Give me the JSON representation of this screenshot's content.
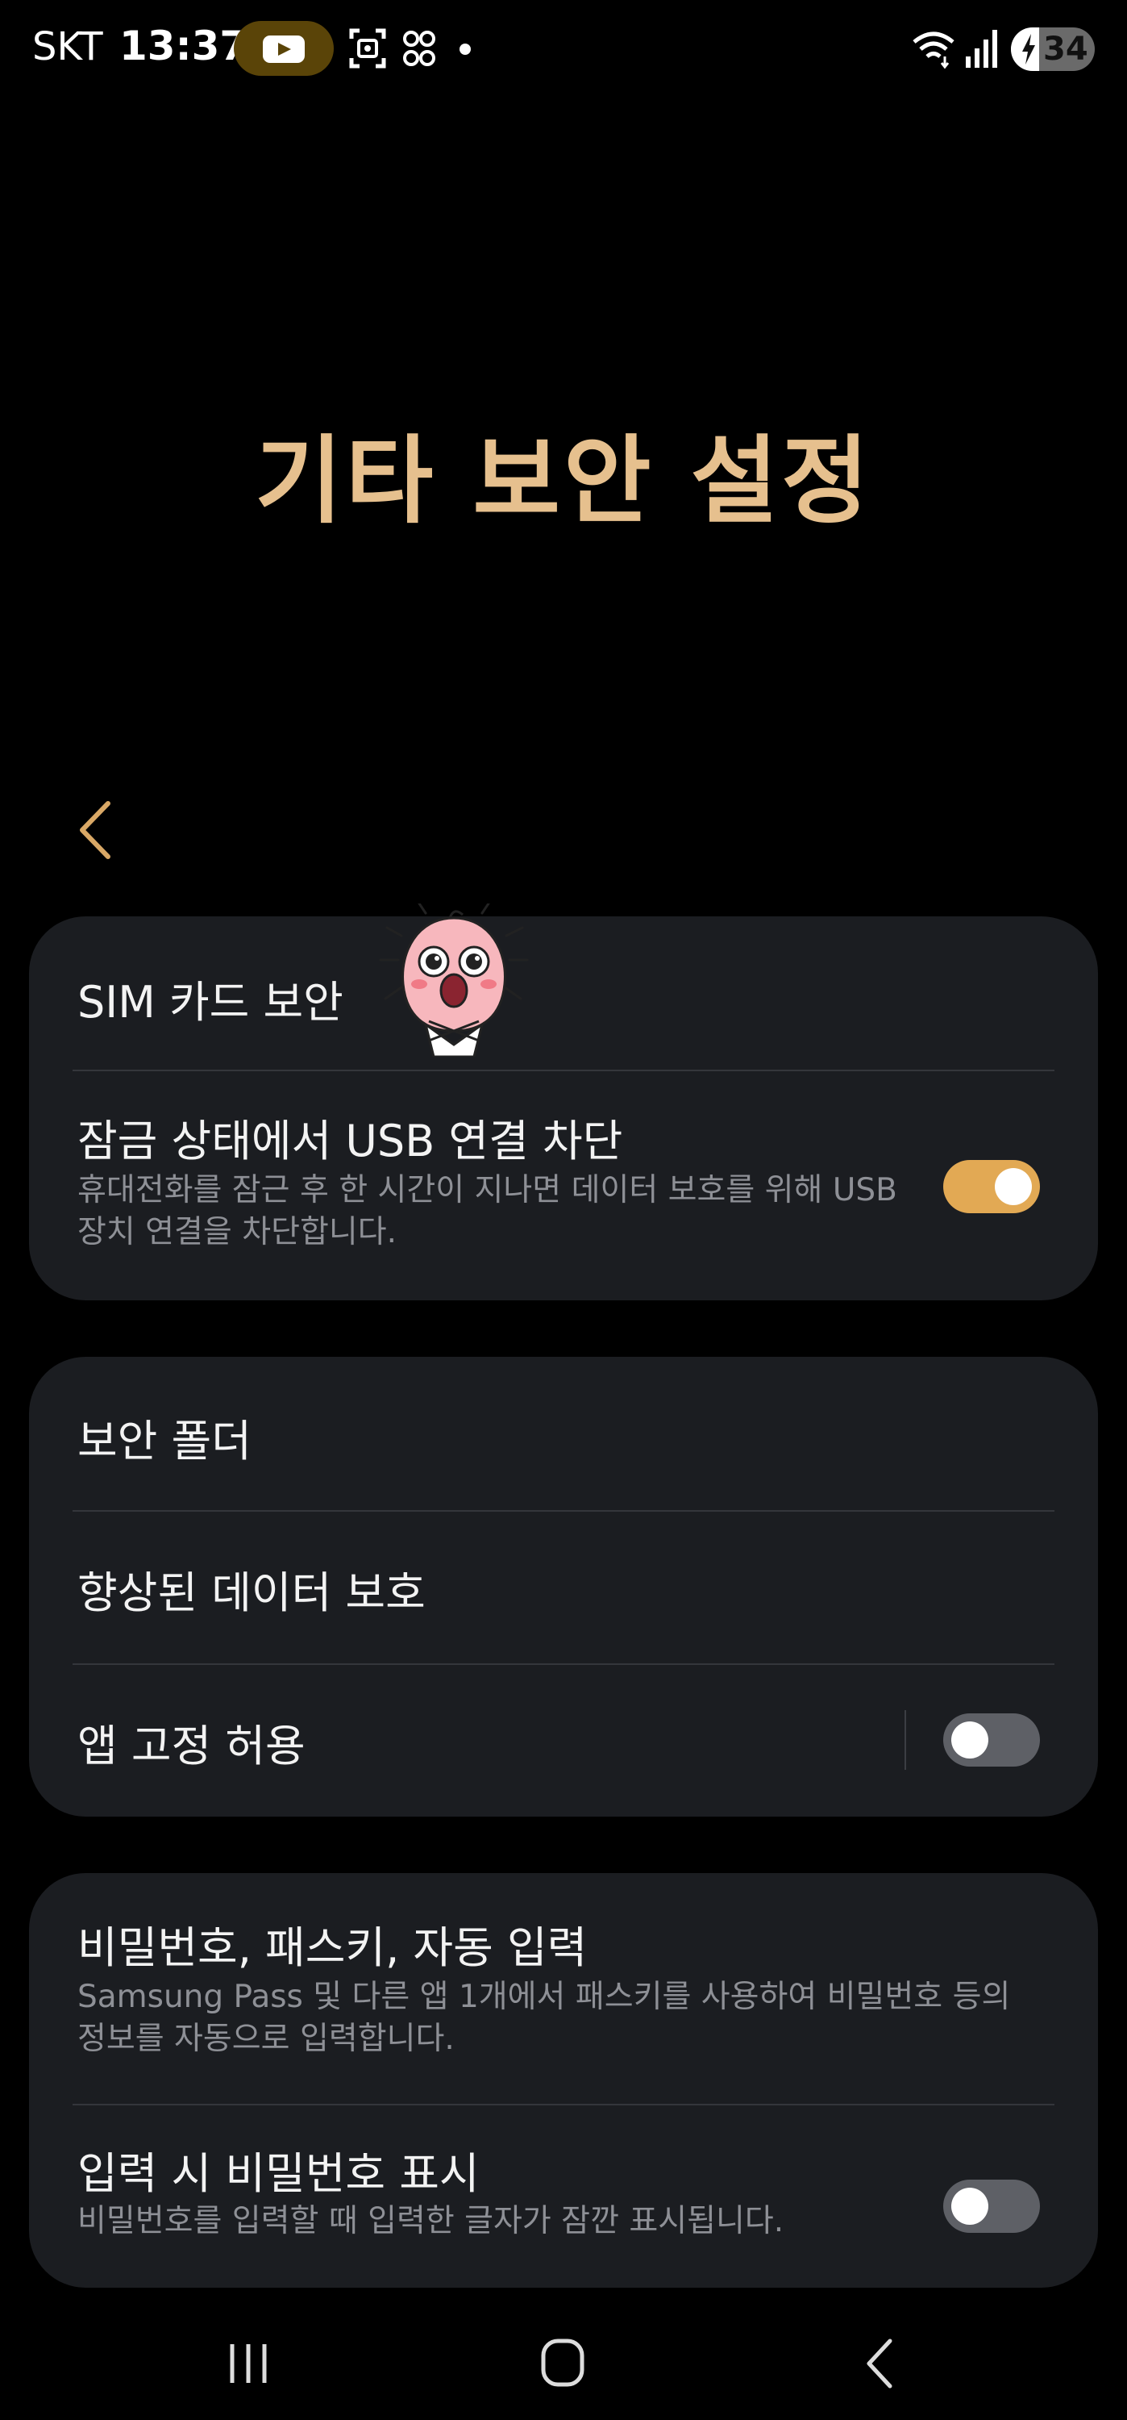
{
  "status_bar": {
    "carrier": "SKT",
    "time": "13:37",
    "battery": "34",
    "battery_level": 0.34,
    "icons": [
      "youtube-icon",
      "screenshot-scan-icon",
      "qr-code-icon",
      "notification-dot-icon",
      "wifi-icon",
      "signal-icon",
      "battery-charging-icon"
    ]
  },
  "page": {
    "title": "기타 보안 설정"
  },
  "sections": [
    {
      "items": [
        {
          "title": "SIM 카드 보안"
        },
        {
          "title": "잠금 상태에서 USB 연결 차단",
          "subtitle": "휴대전화를 잠근 후 한 시간이 지나면 데이터 보호를 위해 USB 장치 연결을 차단합니다.",
          "toggle": true
        }
      ]
    },
    {
      "items": [
        {
          "title": "보안 폴더"
        },
        {
          "title": "향상된 데이터 보호"
        },
        {
          "title": "앱 고정 허용",
          "toggle": false
        }
      ]
    },
    {
      "items": [
        {
          "title": "비밀번호, 패스키, 자동 입력",
          "subtitle": "Samsung Pass 및 다른 앱 1개에서 패스키를 사용하여 비밀번호 등의 정보를 자동으로 입력합니다."
        },
        {
          "title": "입력 시 비밀번호 표시",
          "subtitle": "비밀번호를 입력할 때 입력한 글자가 잠깐 표시됩니다.",
          "toggle": false
        }
      ]
    }
  ],
  "colors": {
    "accent": "#e2a954",
    "title": "#e6c08e",
    "card": "#1b1d21",
    "subtext": "#8e9096"
  },
  "navbar": [
    "recent-apps-icon",
    "home-icon",
    "back-icon"
  ]
}
